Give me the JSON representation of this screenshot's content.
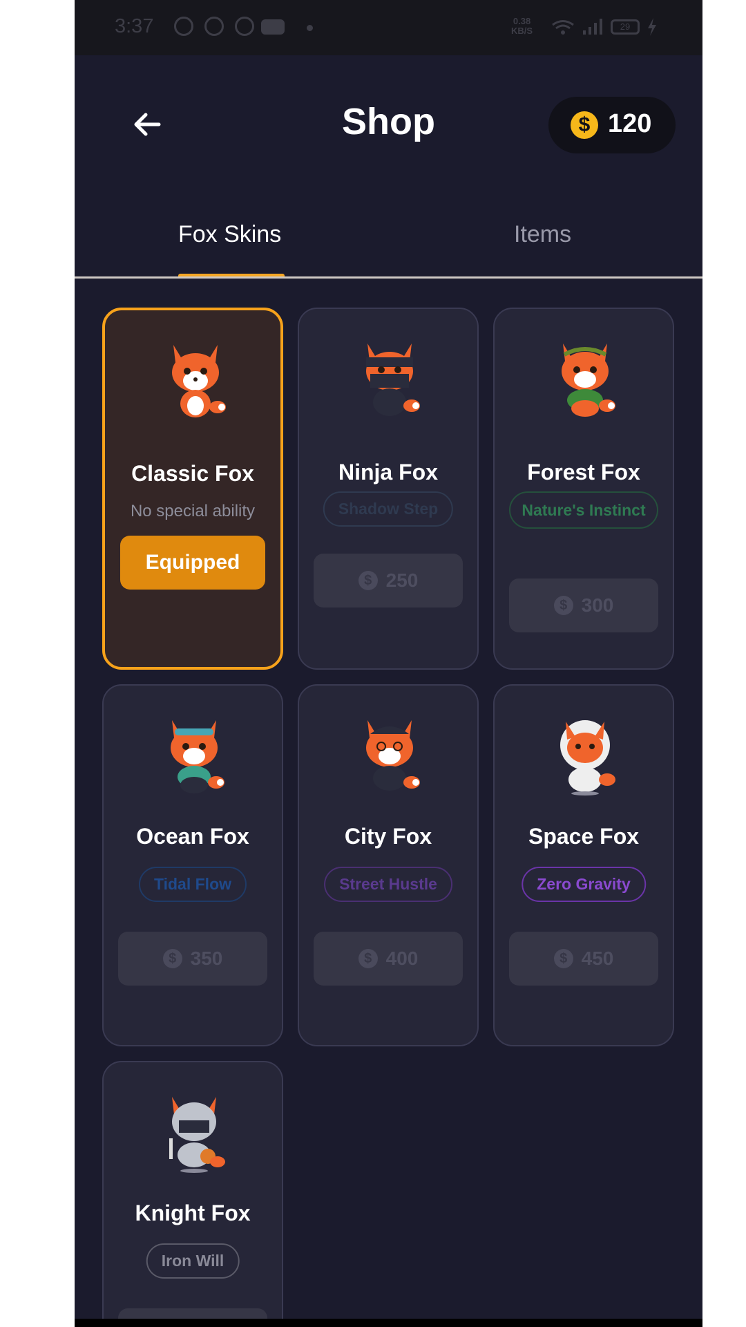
{
  "status": {
    "time": "3:37",
    "speed_top": "0.38",
    "speed_bottom": "KB/S",
    "battery": "29"
  },
  "header": {
    "title": "Shop",
    "coins": "120",
    "coin_symbol": "$"
  },
  "tabs": [
    {
      "label": "Fox Skins",
      "active": true
    },
    {
      "label": "Items",
      "active": false
    }
  ],
  "skins": [
    {
      "name": "Classic Fox",
      "ability": "No special ability",
      "action": "Equipped"
    },
    {
      "name": "Ninja Fox",
      "ability": "Shadow Step",
      "price": "250"
    },
    {
      "name": "Forest Fox",
      "ability": "Nature's Instinct",
      "price": "300"
    },
    {
      "name": "Ocean Fox",
      "ability": "Tidal Flow",
      "price": "350"
    },
    {
      "name": "City Fox",
      "ability": "Street Hustle",
      "price": "400"
    },
    {
      "name": "Space Fox",
      "ability": "Zero Gravity",
      "price": "450"
    },
    {
      "name": "Knight Fox",
      "ability": "Iron Will"
    }
  ],
  "colors": {
    "accent": "#f7a21b",
    "background": "#1b1b2d",
    "card": "#262638"
  }
}
